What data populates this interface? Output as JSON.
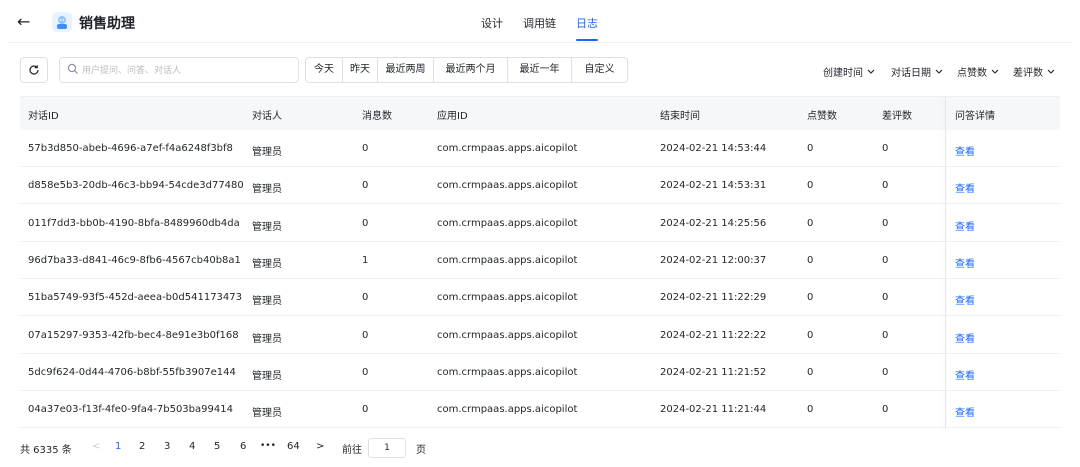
{
  "header": {
    "back_icon": "arrow-left-icon",
    "app_logo_icon": "robot-avatar-icon",
    "app_title": "销售助理",
    "tabs": [
      {
        "label": "设计",
        "active": false
      },
      {
        "label": "调用链",
        "active": false
      },
      {
        "label": "日志",
        "active": true
      }
    ]
  },
  "toolbar": {
    "refresh_icon": "refresh-icon",
    "search_icon": "search-icon",
    "search_placeholder": "用户提问、问答、对话人",
    "search_value": "",
    "filter_icon": "filter-icon",
    "date_filters": [
      "今天",
      "昨天",
      "最近两周",
      "最近两个月",
      "最近一年",
      "自定义"
    ],
    "sorts": [
      "创建时间",
      "对话日期",
      "点赞数",
      "差评数"
    ]
  },
  "table": {
    "columns": [
      "对话ID",
      "对话人",
      "消息数",
      "应用ID",
      "结束时间",
      "点赞数",
      "差评数",
      "问答详情"
    ],
    "rows": [
      [
        "57b3d850-abeb-4696-a7ef-f4a6248f3bf8",
        "管理员",
        "0",
        "com.crmpaas.apps.aicopilot",
        "2024-02-21 14:53:44",
        "0",
        "0",
        "查看"
      ],
      [
        "d858e5b3-20db-46c3-bb94-54cde3d77480",
        "管理员",
        "0",
        "com.crmpaas.apps.aicopilot",
        "2024-02-21 14:53:31",
        "0",
        "0",
        "查看"
      ],
      [
        "011f7dd3-bb0b-4190-8bfa-8489960db4da",
        "管理员",
        "0",
        "com.crmpaas.apps.aicopilot",
        "2024-02-21 14:25:56",
        "0",
        "0",
        "查看"
      ],
      [
        "96d7ba33-d841-46c9-8fb6-4567cb40b8a1",
        "管理员",
        "1",
        "com.crmpaas.apps.aicopilot",
        "2024-02-21 12:00:37",
        "0",
        "0",
        "查看"
      ],
      [
        "51ba5749-93f5-452d-aeea-b0d541173473",
        "管理员",
        "0",
        "com.crmpaas.apps.aicopilot",
        "2024-02-21 11:22:29",
        "0",
        "0",
        "查看"
      ],
      [
        "07a15297-9353-42fb-bec4-8e91e3b0f168",
        "管理员",
        "0",
        "com.crmpaas.apps.aicopilot",
        "2024-02-21 11:22:22",
        "0",
        "0",
        "查看"
      ],
      [
        "5dc9f624-0d44-4706-b8bf-55fb3907e144",
        "管理员",
        "0",
        "com.crmpaas.apps.aicopilot",
        "2024-02-21 11:21:52",
        "0",
        "0",
        "查看"
      ],
      [
        "04a37e03-f13f-4fe0-9fa4-7b503ba99414",
        "管理员",
        "0",
        "com.crmpaas.apps.aicopilot",
        "2024-02-21 11:21:44",
        "0",
        "0",
        "查看"
      ]
    ]
  },
  "pagination": {
    "total_text": "共 6335 条",
    "prev": "<",
    "pages": [
      "1",
      "2",
      "3",
      "4",
      "5",
      "6",
      "•••",
      "64"
    ],
    "current": "1",
    "next": ">",
    "goto_label": "前往",
    "goto_value": "1",
    "page_suffix": "页"
  },
  "colors": {
    "accent": "#1a66ff",
    "header_bg": "#f6f7f9",
    "border": "#dee0e3"
  }
}
